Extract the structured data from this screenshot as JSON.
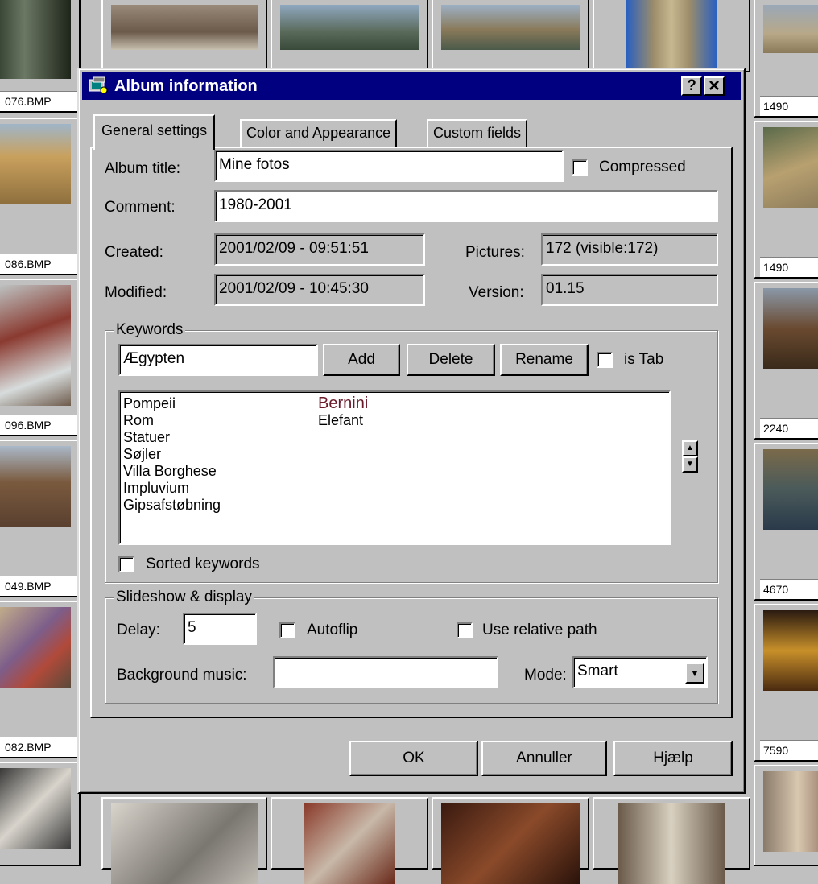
{
  "background_thumbnails": {
    "captions": [
      "076.BMP",
      "086.BMP",
      "096.BMP",
      "049.BMP",
      "082.BMP",
      "1490",
      "1490",
      "2240",
      "4670",
      "7590"
    ]
  },
  "dialog": {
    "title": "Album information",
    "help_btn": "?",
    "close_btn": "×",
    "tabs": [
      "General settings",
      "Color and Appearance",
      "Custom fields"
    ],
    "album_title": {
      "label": "Album title:",
      "value": "Mine fotos"
    },
    "compressed": {
      "label": "Compressed",
      "checked": false
    },
    "comment": {
      "label": "Comment:",
      "value": "1980-2001"
    },
    "created": {
      "label": "Created:",
      "value": "2001/02/09 - 09:51:51"
    },
    "modified": {
      "label": "Modified:",
      "value": "2001/02/09 - 10:45:30"
    },
    "pictures": {
      "label": "Pictures:",
      "value": "172 (visible:172)"
    },
    "version": {
      "label": "Version:",
      "value": "01.15"
    },
    "keywords": {
      "group_label": "Keywords",
      "input_value": "Ægypten",
      "add_btn": "Add",
      "delete_btn": "Delete",
      "rename_btn": "Rename",
      "is_tab": {
        "label": "is Tab",
        "checked": false
      },
      "column1": [
        "Pompeii",
        "Rom",
        "Statuer",
        "Søjler",
        "Villa Borghese",
        "Impluvium",
        "Gipsafstøbning"
      ],
      "column2": [
        "Bernini",
        "Elefant"
      ],
      "sorted": {
        "label": "Sorted keywords",
        "checked": false
      }
    },
    "slideshow": {
      "group_label": "Slideshow & display",
      "delay_label": "Delay:",
      "delay_value": "5",
      "autoflip": {
        "label": "Autoflip",
        "checked": false
      },
      "relative_path": {
        "label": "Use relative path",
        "checked": false
      },
      "bg_music_label": "Background music:",
      "bg_music_value": "",
      "mode_label": "Mode:",
      "mode_value": "Smart"
    },
    "ok_btn": "OK",
    "cancel_btn": "Annuller",
    "help_bottom_btn": "Hjælp"
  },
  "colors": {
    "title_bar": "#000080",
    "face": "#c0c0c0",
    "highlight_keyword": "#6b1a2a"
  }
}
